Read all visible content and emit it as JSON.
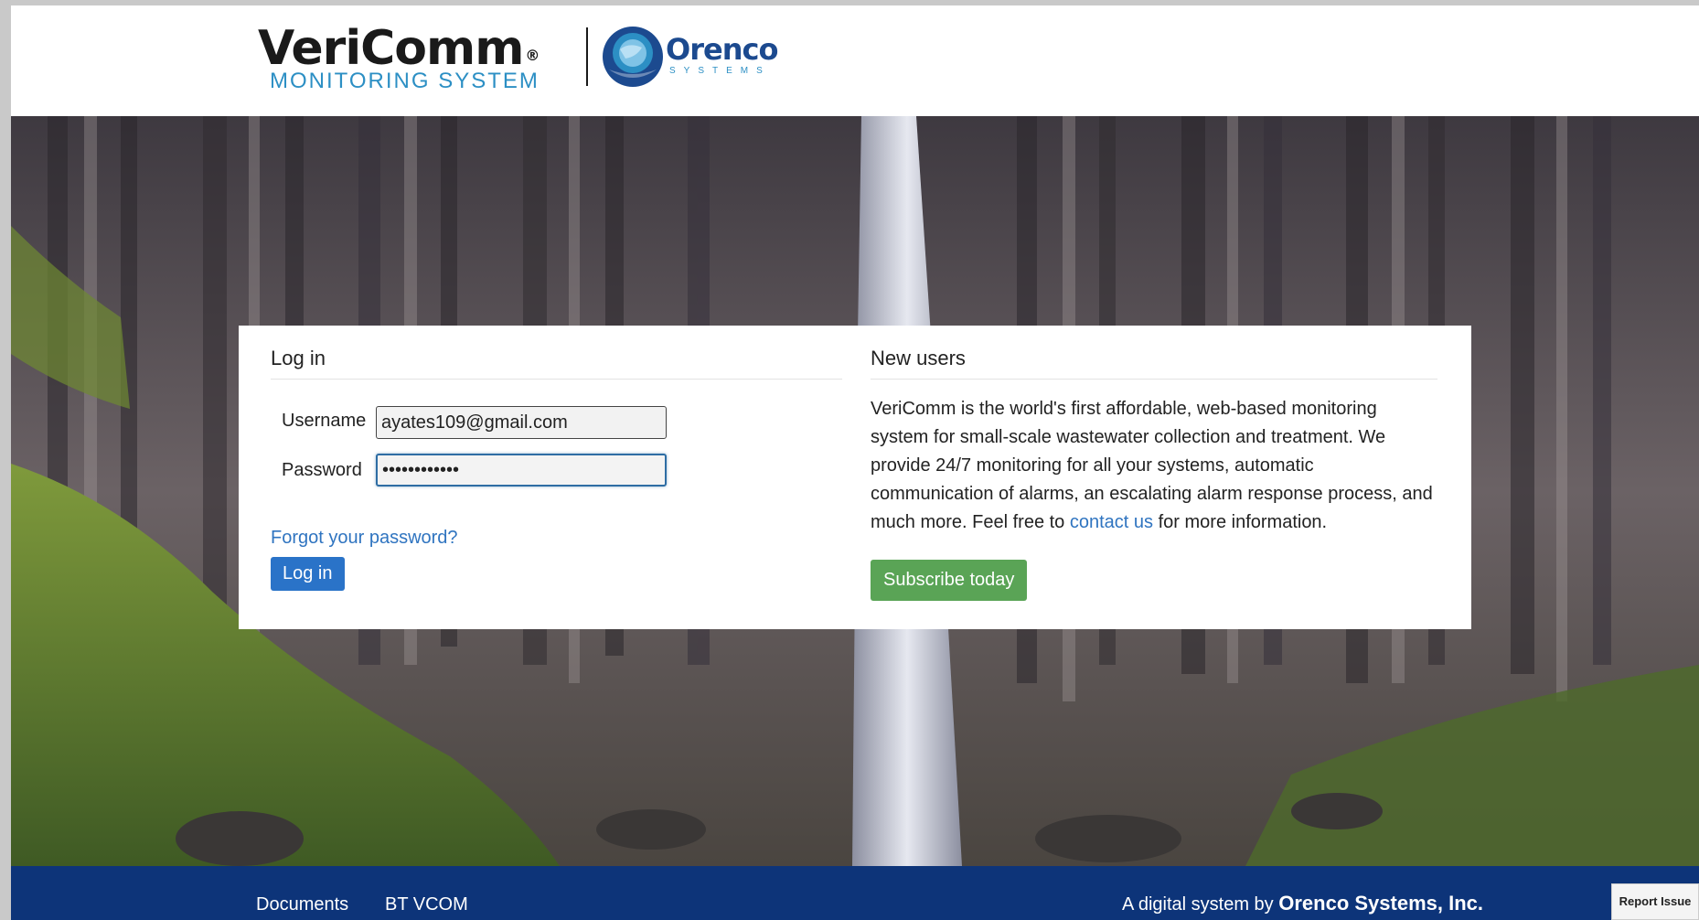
{
  "header": {
    "logo_title": "VeriComm",
    "logo_reg": "®",
    "logo_subtitle": "MONITORING SYSTEM",
    "partner_title": "Orenco",
    "partner_subtitle": "SYSTEMS"
  },
  "login": {
    "title": "Log in",
    "username_label": "Username",
    "username_value": "ayates109@gmail.com",
    "password_label": "Password",
    "password_value": "••••••••••••",
    "forgot_link": "Forgot your password?",
    "submit_label": "Log in"
  },
  "new_users": {
    "title": "New users",
    "text_before_link": "VeriComm is the world's first affordable, web-based monitoring system for small-scale wastewater collection and treatment. We provide 24/7 monitoring for all your systems, automatic communication of alarms, an escalating alarm response process, and much more. Feel free to ",
    "link_text": "contact us",
    "text_after_link": " for more information.",
    "subscribe_label": "Subscribe today"
  },
  "footer": {
    "links": [
      "Documents",
      "BT VCOM"
    ],
    "credit_prefix": "A digital system by ",
    "credit_company": "Orenco Systems, Inc."
  },
  "report_issue_label": "Report Issue",
  "colors": {
    "primary_button": "#2a73c8",
    "subscribe_button": "#5aa456",
    "footer_bg": "#0d3479",
    "link": "#2f74c0"
  }
}
